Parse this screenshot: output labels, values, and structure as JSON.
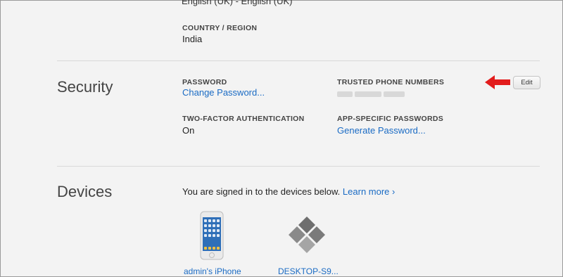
{
  "account": {
    "language_value": "English (UK) - English (UK)",
    "country_label": "COUNTRY / REGION",
    "country_value": "India"
  },
  "security": {
    "title": "Security",
    "password_label": "PASSWORD",
    "change_password_link": "Change Password...",
    "trusted_label": "TRUSTED PHONE NUMBERS",
    "edit_button": "Edit",
    "two_factor_label": "TWO-FACTOR AUTHENTICATION",
    "two_factor_value": "On",
    "app_passwords_label": "APP-SPECIFIC PASSWORDS",
    "generate_password_link": "Generate Password..."
  },
  "devices": {
    "title": "Devices",
    "intro_text": "You are signed in to the devices below.",
    "learn_more_link": "Learn more ›",
    "items": [
      {
        "name": "admin's iPhone",
        "icon": "iphone-icon"
      },
      {
        "name": "DESKTOP-S9...",
        "icon": "windows-pc-icon"
      }
    ]
  },
  "colors": {
    "link": "#1a6bc4",
    "annotation_arrow": "#e21c1c",
    "background": "#f3f3f3"
  }
}
